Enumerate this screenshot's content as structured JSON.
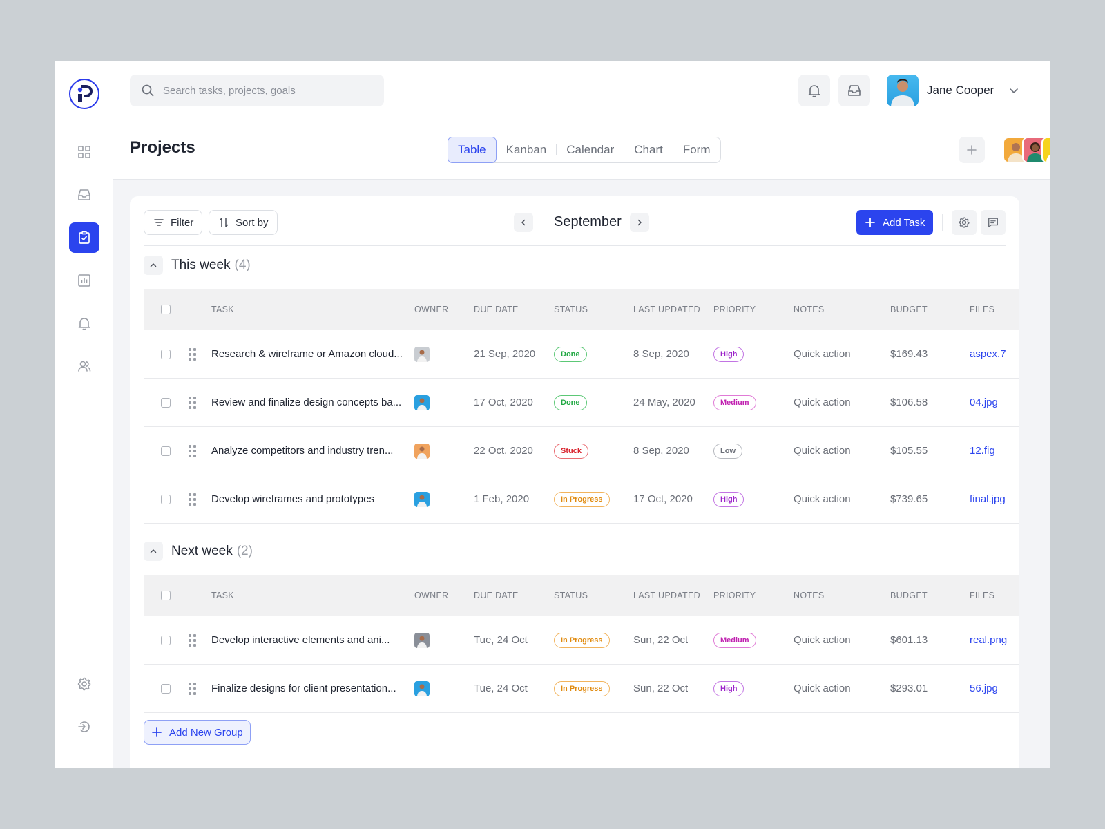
{
  "search": {
    "placeholder": "Search tasks, projects, goals"
  },
  "user": {
    "name": "Jane Cooper"
  },
  "page": {
    "title": "Projects"
  },
  "view_tabs": [
    "Table",
    "Kanban",
    "Calendar",
    "Chart",
    "Form"
  ],
  "active_tab": "Table",
  "sidebar": {
    "items": [
      {
        "name": "dashboard",
        "icon": "grid-icon"
      },
      {
        "name": "inbox",
        "icon": "inbox-icon"
      },
      {
        "name": "tasks",
        "icon": "clipboard-check-icon",
        "active": true
      },
      {
        "name": "reports",
        "icon": "bar-chart-icon"
      },
      {
        "name": "notifications",
        "icon": "bell-icon"
      },
      {
        "name": "team",
        "icon": "users-icon"
      }
    ],
    "bottom": [
      {
        "name": "settings",
        "icon": "gear-icon"
      },
      {
        "name": "logout",
        "icon": "logout-icon"
      }
    ]
  },
  "toolbar": {
    "filter_label": "Filter",
    "sort_label": "Sort by",
    "month": "September",
    "add_task_label": "Add Task"
  },
  "columns": [
    "TASK",
    "OWNER",
    "DUE DATE",
    "STATUS",
    "LAST UPDATED",
    "PRIORITY",
    "NOTES",
    "BUDGET",
    "FILES"
  ],
  "groups": [
    {
      "title": "This week",
      "count": "(4)",
      "rows": [
        {
          "task": "Research & wireframe or Amazon cloud...",
          "owner_color": "#c9cdd2",
          "due": "21 Sep, 2020",
          "status": "Done",
          "updated": "8 Sep, 2020",
          "priority": "High",
          "notes": "Quick action",
          "budget": "$169.43",
          "file": "aspex.7"
        },
        {
          "task": "Review and finalize design concepts ba...",
          "owner_color": "#2aa0e0",
          "due": "17 Oct, 2020",
          "status": "Done",
          "updated": "24 May, 2020",
          "priority": "Medium",
          "notes": "Quick action",
          "budget": "$106.58",
          "file": "04.jpg"
        },
        {
          "task": "Analyze competitors and industry tren...",
          "owner_color": "#f0a35e",
          "due": "22 Oct, 2020",
          "status": "Stuck",
          "updated": "8 Sep, 2020",
          "priority": "Low",
          "notes": "Quick action",
          "budget": "$105.55",
          "file": "12.fig"
        },
        {
          "task": "Develop wireframes and prototypes",
          "owner_color": "#2aa0e0",
          "due": "1 Feb, 2020",
          "status": "In Progress",
          "updated": "17 Oct, 2020",
          "priority": "High",
          "notes": "Quick action",
          "budget": "$739.65",
          "file": "final.jpg"
        }
      ]
    },
    {
      "title": "Next week",
      "count": "(2)",
      "rows": [
        {
          "task": "Develop interactive elements and ani...",
          "owner_color": "#8a8f98",
          "due": "Tue, 24 Oct",
          "status": "In Progress",
          "updated": "Sun, 22 Oct",
          "priority": "Medium",
          "notes": "Quick action",
          "budget": "$601.13",
          "file": "real.png"
        },
        {
          "task": "Finalize designs for client presentation...",
          "owner_color": "#2aa0e0",
          "due": "Tue, 24 Oct",
          "status": "In Progress",
          "updated": "Sun, 22 Oct",
          "priority": "High",
          "notes": "Quick action",
          "budget": "$293.01",
          "file": "56.jpg"
        }
      ]
    }
  ],
  "add_group_label": "Add New Group",
  "colors": {
    "accent": "#2b44ee",
    "background": "#cbd0d4"
  }
}
